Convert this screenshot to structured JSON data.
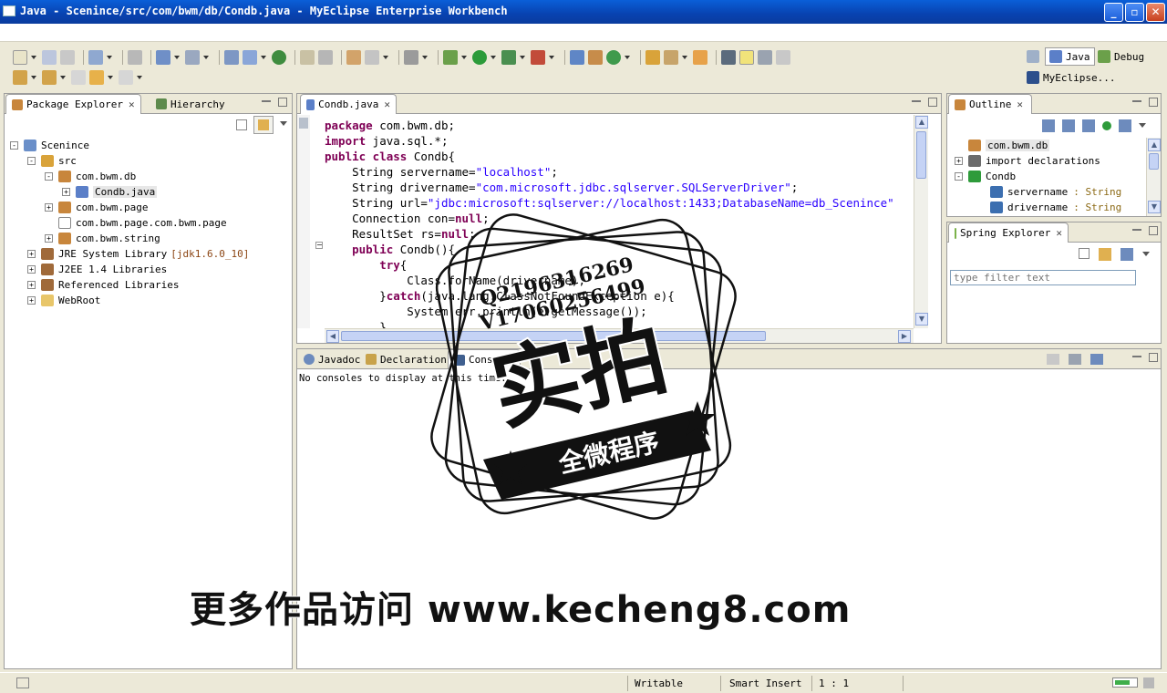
{
  "window": {
    "title": "Java - Scenince/src/com/bwm/db/Condb.java - MyEclipse Enterprise Workbench"
  },
  "perspectives": {
    "java": "Java",
    "debug": "Debug",
    "myeclipse": "MyEclipse..."
  },
  "package_explorer": {
    "tabs": [
      "Package Explorer",
      "Hierarchy"
    ],
    "tree": [
      {
        "label": "Scenince",
        "depth": 0,
        "toggle": "-",
        "icon": "project-icon",
        "color": "#6a8fc9"
      },
      {
        "label": "src",
        "depth": 1,
        "toggle": "-",
        "icon": "source-folder-icon",
        "color": "#d9a33a"
      },
      {
        "label": "com.bwm.db",
        "depth": 2,
        "toggle": "-",
        "icon": "package-icon",
        "color": "#c8863c"
      },
      {
        "label": "Condb.java",
        "depth": 3,
        "toggle": "+",
        "icon": "java-file-icon",
        "color": "#5b7fc8",
        "selected": true
      },
      {
        "label": "com.bwm.page",
        "depth": 2,
        "toggle": "+",
        "icon": "package-icon",
        "color": "#c8863c"
      },
      {
        "label": "com.bwm.page.com.bwm.page",
        "depth": 2,
        "toggle": "",
        "icon": "empty-package-icon",
        "color": "#ffffff"
      },
      {
        "label": "com.bwm.string",
        "depth": 2,
        "toggle": "+",
        "icon": "package-icon",
        "color": "#c8863c"
      },
      {
        "label": "JRE System Library",
        "tag": "[jdk1.6.0_10]",
        "depth": 1,
        "toggle": "+",
        "icon": "library-icon",
        "color": "#a06a3a"
      },
      {
        "label": "J2EE 1.4 Libraries",
        "depth": 1,
        "toggle": "+",
        "icon": "library-icon",
        "color": "#a06a3a"
      },
      {
        "label": "Referenced Libraries",
        "depth": 1,
        "toggle": "+",
        "icon": "library-icon",
        "color": "#a06a3a"
      },
      {
        "label": "WebRoot",
        "depth": 1,
        "toggle": "+",
        "icon": "folder-icon",
        "color": "#e8c66a"
      }
    ]
  },
  "editor": {
    "tab": "Condb.java",
    "lines": [
      [
        {
          "t": "package",
          "c": "kw"
        },
        {
          "t": " com.bwm.db;"
        }
      ],
      [
        {
          "t": "import",
          "c": "kw"
        },
        {
          "t": " java.sql.*;"
        }
      ],
      [
        {
          "t": "public class",
          "c": "kw"
        },
        {
          "t": " Condb{"
        }
      ],
      [
        {
          "t": "    String servername="
        },
        {
          "t": "\"localhost\"",
          "c": "str"
        },
        {
          "t": ";"
        }
      ],
      [
        {
          "t": "    String drivername="
        },
        {
          "t": "\"com.microsoft.jdbc.sqlserver.SQLServerDriver\"",
          "c": "str"
        },
        {
          "t": ";"
        }
      ],
      [
        {
          "t": "    String url="
        },
        {
          "t": "\"jdbc:microsoft:sqlserver://localhost:1433;DatabaseName=db_Scenince\"",
          "c": "str"
        }
      ],
      [
        {
          "t": "    Connection con="
        },
        {
          "t": "null",
          "c": "kw"
        },
        {
          "t": ";"
        }
      ],
      [
        {
          "t": "    ResultSet rs="
        },
        {
          "t": "null",
          "c": "kw"
        },
        {
          "t": ";"
        }
      ],
      [
        {
          "t": "    "
        },
        {
          "t": "public",
          "c": "kw"
        },
        {
          "t": " Condb(){"
        }
      ],
      [
        {
          "t": "        "
        },
        {
          "t": "try",
          "c": "kw"
        },
        {
          "t": "{"
        }
      ],
      [
        {
          "t": "            Class.forName(drivername);"
        }
      ],
      [
        {
          "t": "        }"
        },
        {
          "t": "catch",
          "c": "kw"
        },
        {
          "t": "(java.lang.ClassNotFoundException e){"
        }
      ],
      [
        {
          "t": "            System.err.println(e.getMessage());"
        }
      ],
      [
        {
          "t": "        }"
        }
      ]
    ]
  },
  "outline": {
    "tab": "Outline",
    "tree": [
      {
        "label": "com.bwm.db",
        "depth": 0,
        "toggle": "",
        "icon": "package-icon",
        "color": "#c8863c",
        "selected": true
      },
      {
        "label": "import declarations",
        "depth": 0,
        "toggle": "+",
        "icon": "imports-icon",
        "color": "#6b6b6b"
      },
      {
        "label": "Condb",
        "depth": 0,
        "toggle": "-",
        "icon": "class-icon",
        "color": "#2e9b3a"
      },
      {
        "label": "servername",
        "type": ": String",
        "depth": 1,
        "toggle": "",
        "icon": "field-icon",
        "color": "#3c6fb0"
      },
      {
        "label": "drivername",
        "type": ": String",
        "depth": 1,
        "toggle": "",
        "icon": "field-icon",
        "color": "#3c6fb0"
      }
    ]
  },
  "spring_explorer": {
    "tab": "Spring Explorer",
    "filter_placeholder": "type filter text"
  },
  "bottom_panel": {
    "tabs": [
      "Javadoc",
      "Declaration",
      "Cons"
    ],
    "message": "No consoles to display at this time."
  },
  "status": {
    "writable": "Writable",
    "insert_mode": "Smart Insert",
    "position": "1 : 1"
  },
  "watermarks": {
    "qq1": "Q2196316269",
    "qq2": "V17060256499",
    "stamp_big": "实拍",
    "stamp_banner": "全微程序",
    "site": "更多作品访问 www.kecheng8.com"
  }
}
